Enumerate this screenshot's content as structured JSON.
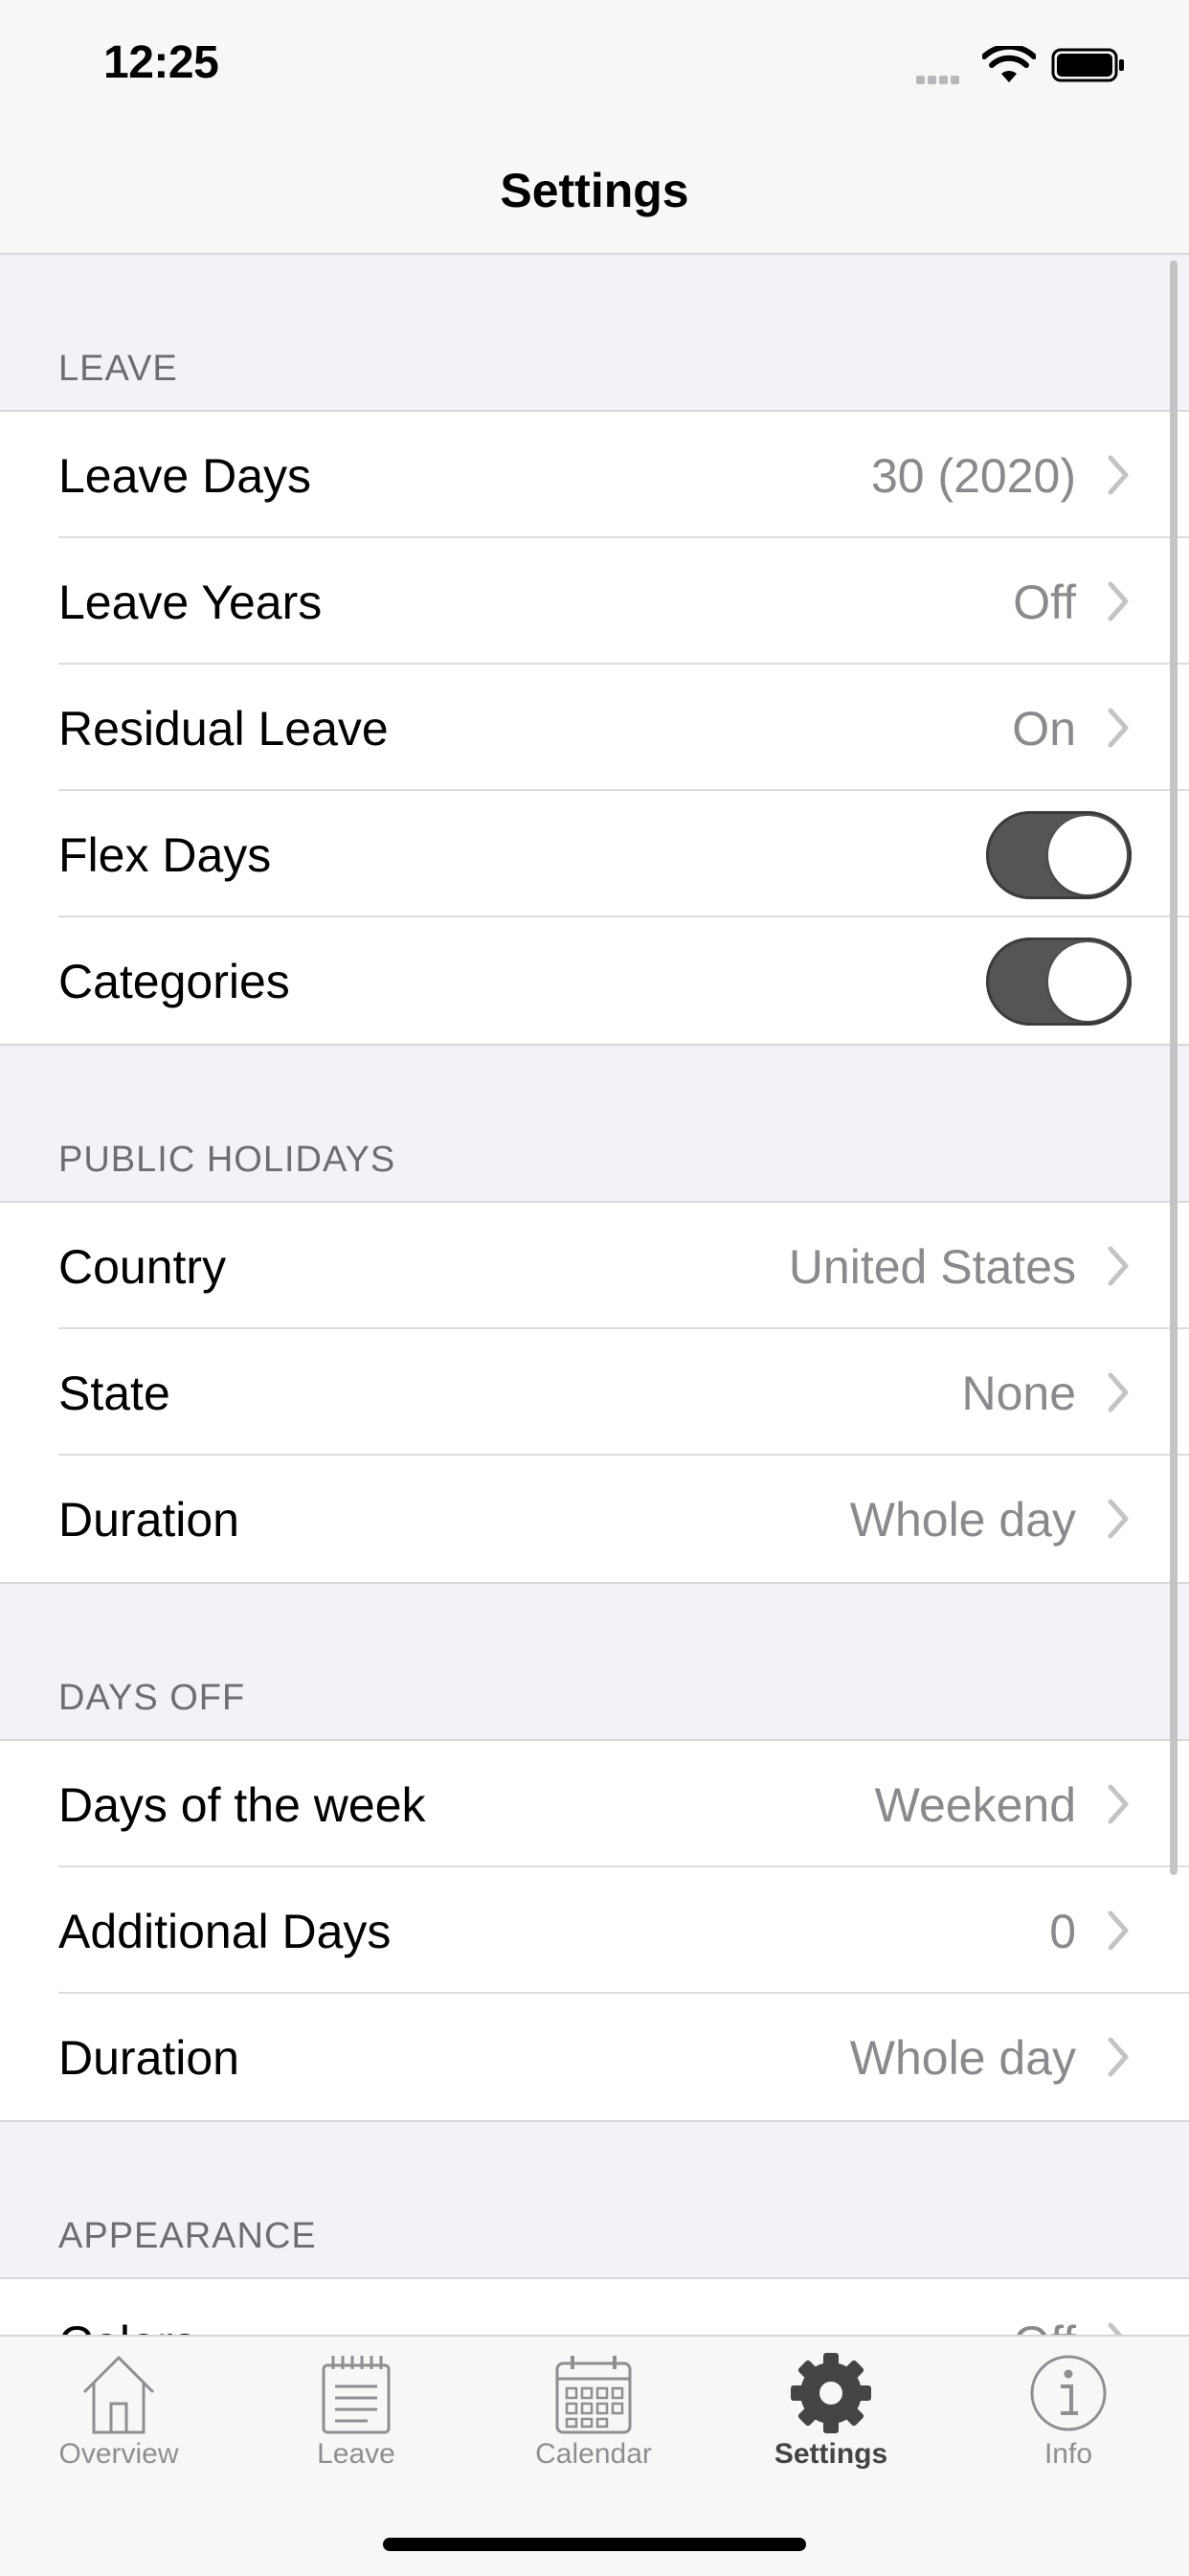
{
  "status_bar": {
    "time": "12:25"
  },
  "nav": {
    "title": "Settings"
  },
  "sections": [
    {
      "header": "LEAVE",
      "rows": [
        {
          "label": "Leave Days",
          "value": "30 (2020)",
          "type": "disclosure"
        },
        {
          "label": "Leave Years",
          "value": "Off",
          "type": "disclosure"
        },
        {
          "label": "Residual Leave",
          "value": "On",
          "type": "disclosure"
        },
        {
          "label": "Flex Days",
          "type": "toggle",
          "on": true
        },
        {
          "label": "Categories",
          "type": "toggle",
          "on": true
        }
      ]
    },
    {
      "header": "PUBLIC HOLIDAYS",
      "rows": [
        {
          "label": "Country",
          "value": "United States",
          "type": "disclosure"
        },
        {
          "label": "State",
          "value": "None",
          "type": "disclosure"
        },
        {
          "label": "Duration",
          "value": "Whole day",
          "type": "disclosure"
        }
      ]
    },
    {
      "header": "DAYS OFF",
      "rows": [
        {
          "label": "Days of the week",
          "value": "Weekend",
          "type": "disclosure"
        },
        {
          "label": "Additional Days",
          "value": "0",
          "type": "disclosure"
        },
        {
          "label": "Duration",
          "value": "Whole day",
          "type": "disclosure"
        }
      ]
    },
    {
      "header": "APPEARANCE",
      "rows": [
        {
          "label": "Colors",
          "value": "Off",
          "type": "disclosure"
        }
      ]
    }
  ],
  "tabs": [
    {
      "label": "Overview",
      "icon": "house-icon",
      "active": false
    },
    {
      "label": "Leave",
      "icon": "notepad-icon",
      "active": false
    },
    {
      "label": "Calendar",
      "icon": "calendar-icon",
      "active": false
    },
    {
      "label": "Settings",
      "icon": "gear-icon",
      "active": true
    },
    {
      "label": "Info",
      "icon": "info-icon",
      "active": false
    }
  ],
  "colors": {
    "toggle_on": "#555557",
    "secondary_text": "#8a8a8e",
    "active_tab": "#444446",
    "inactive_tab": "#8e8e93"
  }
}
